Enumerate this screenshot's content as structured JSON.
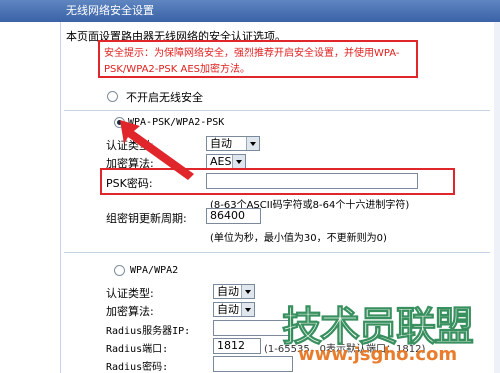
{
  "window": {
    "title": "无线网络安全设置"
  },
  "intro": "本页面设置路由器无线网络的安全认证选项。",
  "tip": {
    "line1": "安全提示：为保障网络安全，强烈推荐开启安全设置，并使用WPA-",
    "line2": "PSK/WPA2-PSK AES加密方法。"
  },
  "options": {
    "disable": "不开启无线安全",
    "wpa_psk": "WPA-PSK/WPA2-PSK",
    "wpa": "WPA/WPA2"
  },
  "psk_section": {
    "auth_label": "认证类型:",
    "auth_value": "自动",
    "enc_label": "加密算法:",
    "enc_value": "AES",
    "psk_label": "PSK密码:",
    "psk_value": "",
    "psk_hint": "(8-63个ASCII码字符或8-64个十六进制字符)",
    "rekey_label": "组密钥更新周期:",
    "rekey_value": "86400",
    "rekey_hint": "(单位为秒，最小值为30，不更新则为0)"
  },
  "wpa_section": {
    "auth_label": "认证类型:",
    "auth_value": "自动",
    "enc_label": "加密算法:",
    "enc_value": "自动",
    "radius_ip_label": "Radius服务器IP:",
    "radius_ip_value": "",
    "radius_port_label": "Radius端口:",
    "radius_port_value": "1812",
    "radius_port_hint": "(1-65535，0表示默认端口：1812)",
    "radius_pwd_label": "Radius密码:",
    "radius_pwd_value": ""
  },
  "watermark": {
    "logo": "技术员联盟",
    "url": "www.jsgho.com"
  },
  "colors": {
    "title_bar": "#3a62a6",
    "highlight_border": "#e0262b",
    "tip_text": "#e02020"
  }
}
